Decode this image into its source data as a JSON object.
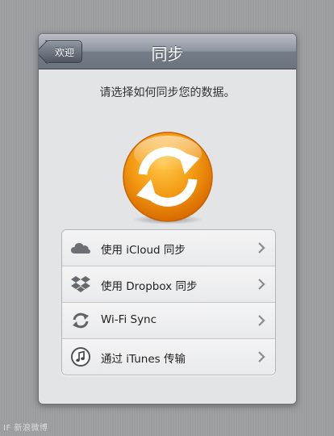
{
  "navbar": {
    "title": "同步",
    "back_label": "欢迎"
  },
  "prompt": "请选择如何同步您的数据。",
  "sync_icon": "sync-arrows-icon",
  "options": [
    {
      "label": "使用 iCloud 同步",
      "icon": "icloud-icon"
    },
    {
      "label": "使用 Dropbox 同步",
      "icon": "dropbox-icon"
    },
    {
      "label": "Wi-Fi Sync",
      "icon": "wifi-sync-icon"
    },
    {
      "label": "通过 iTunes 传输",
      "icon": "itunes-icon"
    }
  ],
  "watermark": "IF 新浪微博",
  "colors": {
    "accent_orange": "#f08a00",
    "navbar": "#7a818c"
  }
}
